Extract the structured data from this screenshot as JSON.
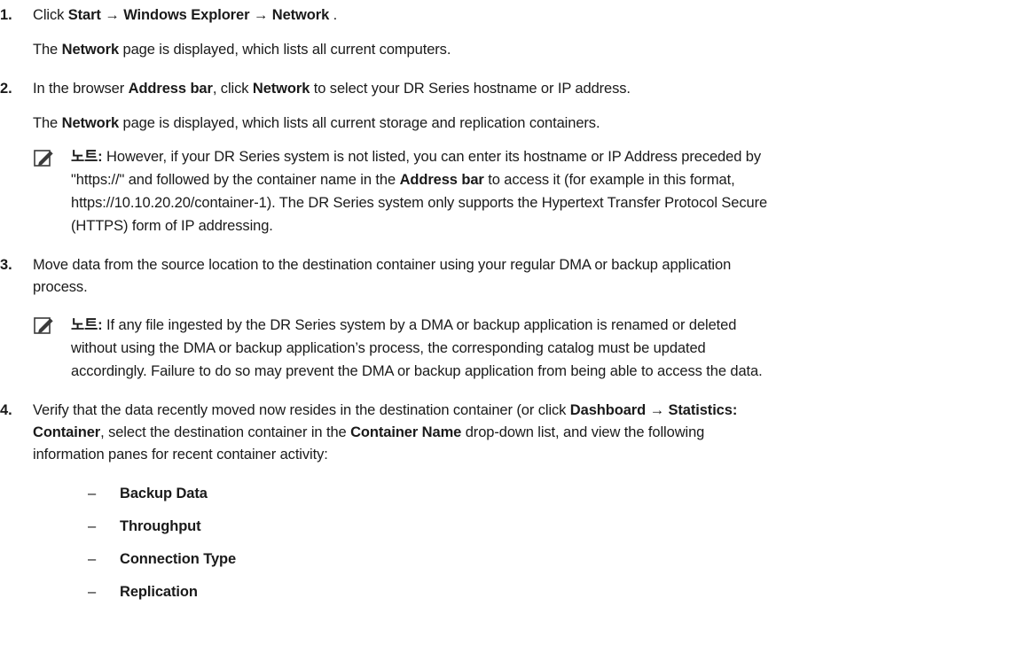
{
  "steps": [
    {
      "number": "1.",
      "line1": {
        "pre": "Click ",
        "start": "Start",
        "arrow1": " → ",
        "explorer": "Windows Explorer",
        "arrow2": " → ",
        "network": "Network",
        "post": " ."
      },
      "line2": {
        "pre": "The ",
        "bold": "Network",
        "post": " page is displayed, which lists all current computers."
      }
    },
    {
      "number": "2.",
      "line1": {
        "pre": "In the browser ",
        "bold1": "Address bar",
        "mid": ", click ",
        "bold2": "Network",
        "post": " to select your DR Series hostname or IP address."
      },
      "line2": {
        "pre": "The ",
        "bold": "Network",
        "post": " page is displayed, which lists all current storage and replication containers."
      },
      "note": {
        "label": "노트:",
        "line1": " However, if your DR Series system is not listed, you can enter its hostname or IP Address preceded by",
        "line2_pre": "\"https://\" and followed by the container name in the ",
        "line2_bold": "Address bar",
        "line2_post": " to access it (for example in this format,",
        "line3": "https://10.10.20.20/container-1). The DR Series system only supports the Hypertext Transfer Protocol Secure",
        "line4": "(HTTPS) form of IP addressing."
      }
    },
    {
      "number": "3.",
      "line1": "Move data from the source location to the destination container using your regular DMA or backup application",
      "line2": "process.",
      "note": {
        "label": "노트:",
        "line1": " If any file ingested by the DR Series system by a DMA or backup application is renamed or deleted",
        "line2": "without using the DMA or backup application’s process, the corresponding catalog must be updated",
        "line3": "accordingly. Failure to do so may prevent the DMA or backup application from being able to access the data."
      }
    },
    {
      "number": "4.",
      "line1": {
        "pre": "Verify that the data recently moved now resides in the destination container (or click ",
        "bold1": "Dashboard",
        "arrow": " → ",
        "bold2": "Statistics:"
      },
      "line2": {
        "bold1": "Container",
        "mid1": ", select the destination container in the ",
        "bold2": "Container Name",
        "post": " drop-down list, and view the following"
      },
      "line3": "information panes for recent container activity:",
      "bullets": [
        "Backup Data",
        "Throughput",
        "Connection Type",
        "Replication"
      ],
      "bullet_marker": "–"
    }
  ],
  "colors": {
    "text": "#1a1a1a",
    "icon_fill": "#3a3a3a"
  },
  "icon": "note-pencil-icon"
}
